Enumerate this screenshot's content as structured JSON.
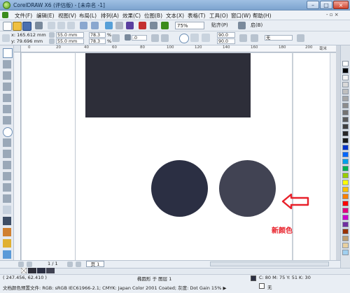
{
  "window": {
    "title": "CorelDRAW X6 (评估版) - [未命名 -1]",
    "min_icon": "minimize-icon",
    "max_icon": "maximize-icon",
    "close_icon": "close-icon"
  },
  "menu": {
    "items": [
      "文件(F)",
      "编辑(E)",
      "视图(V)",
      "布局(L)",
      "排列(A)",
      "效果(C)",
      "位图(B)",
      "文本(X)",
      "表格(T)",
      "工具(O)",
      "窗口(W)",
      "帮助(H)"
    ],
    "controls": "- ▫ ×"
  },
  "toolbar": {
    "zoom": "75%",
    "snap": "贴齐(P)",
    "launch": "启(B)"
  },
  "property_bar": {
    "x": "x: 165.612 mm",
    "y": "y: 79.696 mm",
    "width": "55.0 mm",
    "height": "55.0 mm",
    "scale_x": "78.3",
    "scale_y": "78.3",
    "pct": "%",
    "rotation": ".0",
    "angle1": "90.0",
    "angle2": "90.0",
    "outline": "无"
  },
  "ruler": {
    "labels": [
      "0",
      "20",
      "40",
      "60",
      "80",
      "100",
      "120",
      "140",
      "160",
      "180",
      "200"
    ],
    "unit": "毫米"
  },
  "canvas": {
    "rect_color": "#2d2e39",
    "circle_a_color": "#2b2f43",
    "circle_b_color": "#414353",
    "arrow_color": "#e8202a",
    "annotation": "新颜色"
  },
  "page_nav": {
    "count": "1 / 1",
    "tab": "页 1"
  },
  "status": {
    "coords": "( 247.456, 62.410 )",
    "object": "椭圆形 于 图层 1",
    "fill": "C: 80 M: 75 Y: 51 K: 30",
    "profile": "文档颜色预置文件: RGB: sRGB IEC61966-2.1; CMYK: Japan Color 2001 Coated; 灰度: Dot Gain 15%",
    "profile_arrow": "▶",
    "outline": "无"
  },
  "palette": {
    "colors": [
      "#ffffff",
      "#000000",
      "#f2f2f2",
      "#d9d9d9",
      "#bfbfbf",
      "#a6a6a6",
      "#8c8c8c",
      "#737373",
      "#595959",
      "#404040",
      "#262626",
      "#1a1a1a",
      "#0033cc",
      "#0066ff",
      "#00a0e9",
      "#00b050",
      "#99cc00",
      "#ffff00",
      "#ffc000",
      "#ff8000",
      "#ff0000",
      "#e4007f",
      "#cc00cc",
      "#7030a0",
      "#993300",
      "#c0a070",
      "#e8d0a0",
      "#a0d0f0"
    ]
  }
}
